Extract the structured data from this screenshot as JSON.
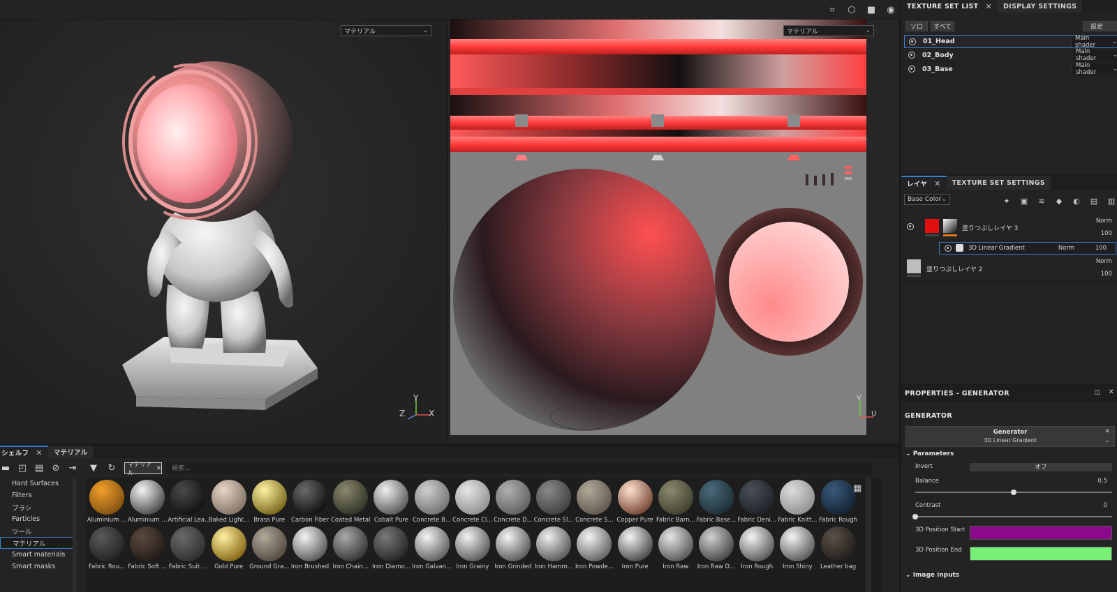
{
  "topbar": {
    "icons": [
      "symmetry-icon",
      "cube-icon",
      "camera-icon",
      "screenshot-icon"
    ]
  },
  "viewport3d": {
    "select_label": "マテリアル",
    "axes": {
      "y": "Y",
      "z": "Z",
      "x": "X"
    }
  },
  "viewport2d": {
    "select_label": "マテリアル",
    "axes": {
      "v": "V",
      "u": "U"
    }
  },
  "texture_set_list": {
    "tab_label": "TEXTURE SET LIST",
    "tab2_label": "DISPLAY SETTINGS",
    "solo_label": "ソロ",
    "all_label": "すべて",
    "settings_label": "設定",
    "items": [
      {
        "name": "01_Head",
        "shader": "Main shader"
      },
      {
        "name": "02_Body",
        "shader": "Main shader"
      },
      {
        "name": "03_Base",
        "shader": "Main shader"
      }
    ]
  },
  "layers": {
    "tab_label": "レイヤ",
    "tab2_label": "TEXTURE SET SETTINGS",
    "channel_select": "Base Color",
    "rows": [
      {
        "name": "塗りつぶしレイヤ 3",
        "blend": "Norm",
        "opacity": "100",
        "color": "#e01010"
      },
      {
        "name": "3D Linear Gradient",
        "blend": "Norm",
        "opacity": "100"
      },
      {
        "name": "塗りつぶしレイヤ 2",
        "blend": "Norm",
        "opacity": "100",
        "color": "#bdbdbd"
      }
    ]
  },
  "properties": {
    "title": "PROPERTIES - GENERATOR",
    "section": "GENERATOR",
    "generator_label": "Generator",
    "generator_value": "3D Linear Gradient",
    "parameters_label": "Parameters",
    "invert_label": "Invert",
    "invert_value": "オフ",
    "balance_label": "Balance",
    "balance_value": "0.5",
    "contrast_label": "Contrast",
    "contrast_value": "0",
    "pos_start_label": "3D Position Start",
    "pos_end_label": "3D Position End",
    "image_inputs_label": "Image inputs",
    "colors": {
      "pos_start": "#8a0a8a",
      "pos_end": "#78f078"
    }
  },
  "shelf": {
    "tab_label": "シェルフ",
    "tab2_label": "マテリアル",
    "filter_chip": "マテリアル",
    "search_placeholder": "検索...",
    "categories": [
      "Hard Surfaces",
      "Filters",
      "ブラシ",
      "Particles",
      "ツール",
      "マテリアル",
      "Smart materials",
      "Smart masks"
    ],
    "active_category": 5,
    "materials": [
      {
        "name": "Aluminium ...",
        "c1": "#f0a02a",
        "c2": "#7a4a10"
      },
      {
        "name": "Aluminium ...",
        "c1": "#f4f4f4",
        "c2": "#3a3a3a"
      },
      {
        "name": "Artificial Lea...",
        "c1": "#4a4a4a",
        "c2": "#0d0d0d"
      },
      {
        "name": "Baked Light...",
        "c1": "#e6d6c6",
        "c2": "#7a6a5e"
      },
      {
        "name": "Brass Pure",
        "c1": "#fff2a0",
        "c2": "#6a5a10"
      },
      {
        "name": "Carbon Fiber",
        "c1": "#6a6a6a",
        "c2": "#0a0a0a"
      },
      {
        "name": "Coated Metal",
        "c1": "#8a8a70",
        "c2": "#2a2a20"
      },
      {
        "name": "Cobalt Pure",
        "c1": "#f0f0f0",
        "c2": "#4a4a4a"
      },
      {
        "name": "Concrete B...",
        "c1": "#cfcfcf",
        "c2": "#6a6a6a"
      },
      {
        "name": "Concrete Cl...",
        "c1": "#e6e6e6",
        "c2": "#8a8a8a"
      },
      {
        "name": "Concrete D...",
        "c1": "#b0b0b0",
        "c2": "#5a5a5a"
      },
      {
        "name": "Concrete Sl...",
        "c1": "#8a8a8a",
        "c2": "#3a3a3a"
      },
      {
        "name": "Concrete S...",
        "c1": "#b0a898",
        "c2": "#5a5248"
      },
      {
        "name": "Copper Pure",
        "c1": "#ffe0d0",
        "c2": "#6a3a28"
      },
      {
        "name": "Fabric Barn...",
        "c1": "#8a8a70",
        "c2": "#3a3a28"
      },
      {
        "name": "Fabric Base...",
        "c1": "#4a6a7a",
        "c2": "#1a2a32"
      },
      {
        "name": "Fabric Deni...",
        "c1": "#4a5058",
        "c2": "#1a1e24"
      },
      {
        "name": "Fabric Knitt...",
        "c1": "#dcdcdc",
        "c2": "#8a8a8a"
      },
      {
        "name": "Fabric Rough",
        "c1": "#3a5a7a",
        "c2": "#101e2c"
      },
      {
        "name": "Fabric Rou...",
        "c1": "#5a5a5a",
        "c2": "#1e1e1e"
      },
      {
        "name": "Fabric Soft ...",
        "c1": "#5a4a40",
        "c2": "#201814"
      },
      {
        "name": "Fabric Suit ...",
        "c1": "#6a6a6a",
        "c2": "#2a2a2a"
      },
      {
        "name": "Gold Pure",
        "c1": "#fff0a0",
        "c2": "#7a5a08"
      },
      {
        "name": "Ground Gra...",
        "c1": "#b0a898",
        "c2": "#4a4238"
      },
      {
        "name": "Iron Brushed",
        "c1": "#f4f4f4",
        "c2": "#4a4a4a"
      },
      {
        "name": "Iron Chain...",
        "c1": "#aaaaaa",
        "c2": "#2a2a2a"
      },
      {
        "name": "Iron Diamo...",
        "c1": "#7a7a7a",
        "c2": "#1e1e1e"
      },
      {
        "name": "Iron Galvan...",
        "c1": "#f4f4f4",
        "c2": "#505050"
      },
      {
        "name": "Iron Grainy",
        "c1": "#f4f4f4",
        "c2": "#4a4a4a"
      },
      {
        "name": "Iron Grinded",
        "c1": "#f4f4f4",
        "c2": "#4a4a4a"
      },
      {
        "name": "Iron Hamm...",
        "c1": "#f0f0f0",
        "c2": "#4a4a4a"
      },
      {
        "name": "Iron Powde...",
        "c1": "#f4f4f4",
        "c2": "#555555"
      },
      {
        "name": "Iron Pure",
        "c1": "#f4f4f4",
        "c2": "#3a3a3a"
      },
      {
        "name": "Iron Raw",
        "c1": "#e6e6e6",
        "c2": "#4a4a4a"
      },
      {
        "name": "Iron Raw D...",
        "c1": "#d0d0d0",
        "c2": "#3a3a3a"
      },
      {
        "name": "Iron Rough",
        "c1": "#f4f4f4",
        "c2": "#4a4a4a"
      },
      {
        "name": "Iron Shiny",
        "c1": "#f4f4f4",
        "c2": "#4a4a4a"
      },
      {
        "name": "Leather bag",
        "c1": "#5a5048",
        "c2": "#1e1a16"
      }
    ]
  }
}
